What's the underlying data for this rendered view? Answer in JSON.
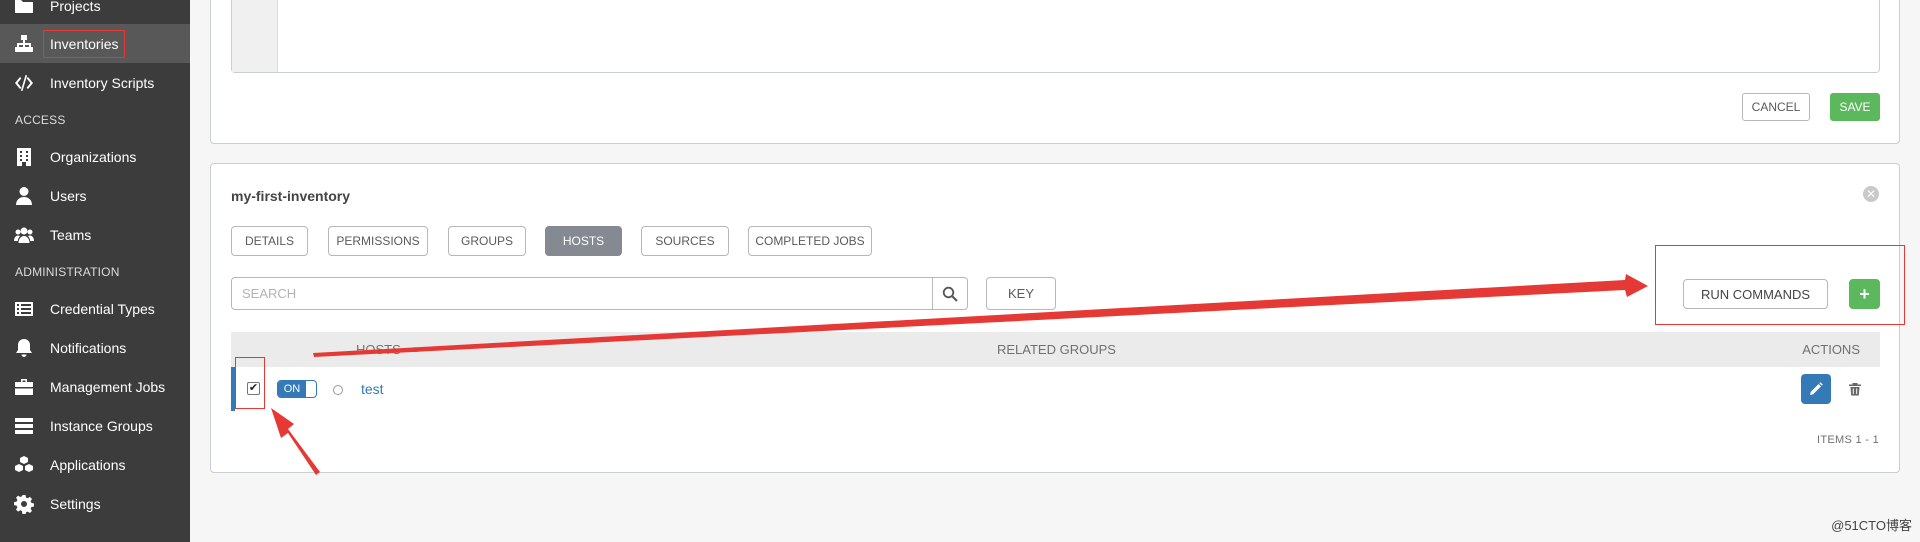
{
  "sidebar": {
    "items": [
      {
        "label": "Projects",
        "icon": "folder-icon"
      },
      {
        "label": "Inventories",
        "icon": "sitemap-icon"
      },
      {
        "label": "Inventory Scripts",
        "icon": "code-icon"
      },
      {
        "label": "Organizations",
        "icon": "building-icon"
      },
      {
        "label": "Users",
        "icon": "user-icon"
      },
      {
        "label": "Teams",
        "icon": "users-icon"
      },
      {
        "label": "Credential Types",
        "icon": "list-alt-icon"
      },
      {
        "label": "Notifications",
        "icon": "bell-icon"
      },
      {
        "label": "Management Jobs",
        "icon": "briefcase-icon"
      },
      {
        "label": "Instance Groups",
        "icon": "server-icon"
      },
      {
        "label": "Applications",
        "icon": "cubes-icon"
      },
      {
        "label": "Settings",
        "icon": "gear-icon"
      }
    ],
    "sections": {
      "access": "ACCESS",
      "administration": "ADMINISTRATION"
    },
    "active_item": "Inventories"
  },
  "form": {
    "cancel_label": "CANCEL",
    "save_label": "SAVE"
  },
  "inventory": {
    "title": "my-first-inventory",
    "tabs": [
      "DETAILS",
      "PERMISSIONS",
      "GROUPS",
      "HOSTS",
      "SOURCES",
      "COMPLETED JOBS"
    ],
    "selected_tab": "HOSTS",
    "search_placeholder": "SEARCH",
    "key_label": "KEY",
    "run_commands_label": "RUN COMMANDS",
    "add_label": "+",
    "columns": {
      "hosts": "HOSTS",
      "related_groups": "RELATED GROUPS",
      "actions": "ACTIONS"
    },
    "sort_indicator": "▲",
    "rows": [
      {
        "checked": true,
        "toggle": "ON",
        "name": "test",
        "related_groups": ""
      }
    ],
    "items_label": "ITEMS  1 - 1"
  },
  "watermark": "@51CTO博客",
  "colors": {
    "sidebar_bg": "#3c3c3c",
    "active_item_bg": "#585858",
    "primary": "#337ab7",
    "success": "#5cb85c",
    "annotation_red": "#e53935"
  }
}
